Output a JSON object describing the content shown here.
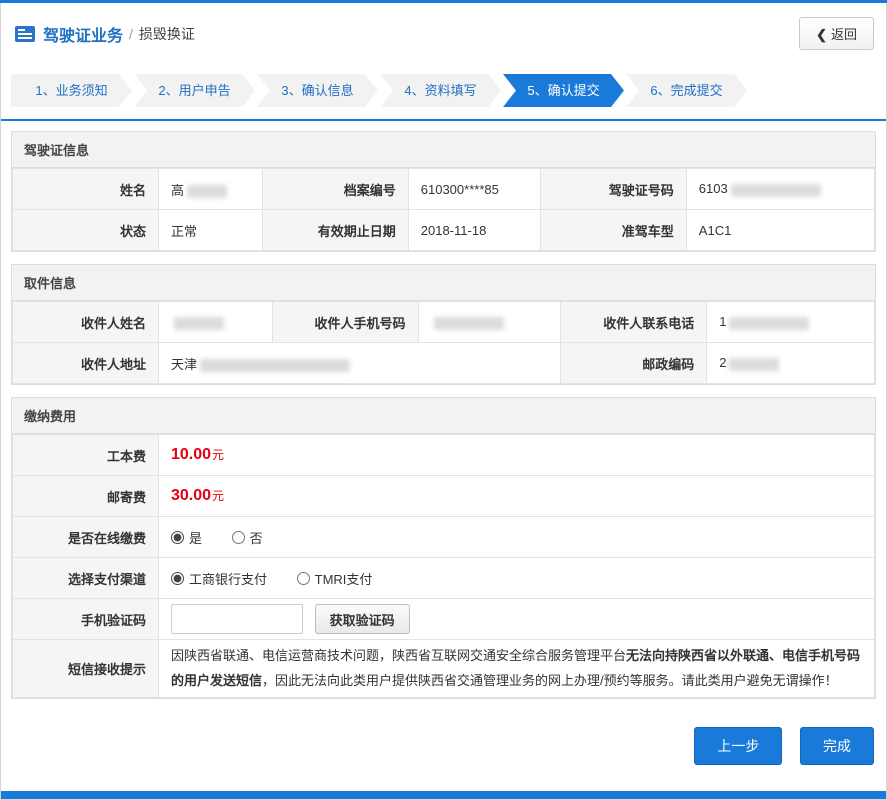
{
  "header": {
    "title": "驾驶证业务",
    "separator": "/",
    "subtitle": "损毁换证",
    "back_chevron": "❮",
    "back_label": "返回"
  },
  "steps": {
    "items": [
      {
        "label": "1、业务须知",
        "active": false
      },
      {
        "label": "2、用户申告",
        "active": false
      },
      {
        "label": "3、确认信息",
        "active": false
      },
      {
        "label": "4、资料填写",
        "active": false
      },
      {
        "label": "5、确认提交",
        "active": true
      },
      {
        "label": "6、完成提交",
        "active": false
      }
    ]
  },
  "license_section": {
    "title": "驾驶证信息",
    "fields": {
      "name_label": "姓名",
      "name_value": "高",
      "file_no_label": "档案编号",
      "file_no_value": "610300****85",
      "license_no_label": "驾驶证号码",
      "license_no_value": "6103",
      "status_label": "状态",
      "status_value": "正常",
      "expiry_label": "有效期止日期",
      "expiry_value": "2018-11-18",
      "vehicle_label": "准驾车型",
      "vehicle_value": "A1C1"
    }
  },
  "pickup_section": {
    "title": "取件信息",
    "fields": {
      "recipient_name_label": "收件人姓名",
      "recipient_name_value": "",
      "recipient_phone_label": "收件人手机号码",
      "recipient_phone_value": "",
      "recipient_tel_label": "收件人联系电话",
      "recipient_tel_value": "1",
      "address_label": "收件人地址",
      "address_value": "天津",
      "postal_label": "邮政编码",
      "postal_value": "2"
    }
  },
  "fee_section": {
    "title": "缴纳费用",
    "production_fee_label": "工本费",
    "production_fee_amount": "10.00",
    "production_fee_unit": "元",
    "mail_fee_label": "邮寄费",
    "mail_fee_amount": "30.00",
    "mail_fee_unit": "元",
    "online_pay_label": "是否在线缴费",
    "online_pay_yes": "是",
    "online_pay_no": "否",
    "channel_label": "选择支付渠道",
    "channel_icbc": "工商银行支付",
    "channel_tmri": "TMRI支付",
    "sms_code_label": "手机验证码",
    "get_code_button": "获取验证码",
    "sms_notice_label": "短信接收提示",
    "sms_notice_part1": "因陕西省联通、电信运营商技术问题，陕西省互联网交通安全综合服务管理平台",
    "sms_notice_part2": "无法向持陕西省以外联通、电信手机号码的用户发送短信",
    "sms_notice_part3": "，因此无法向此类用户提供陕西省交通管理业务的网上办理/预约等服务。请此类用户避免无谓操作！"
  },
  "footer": {
    "prev_button": "上一步",
    "finish_button": "完成"
  }
}
